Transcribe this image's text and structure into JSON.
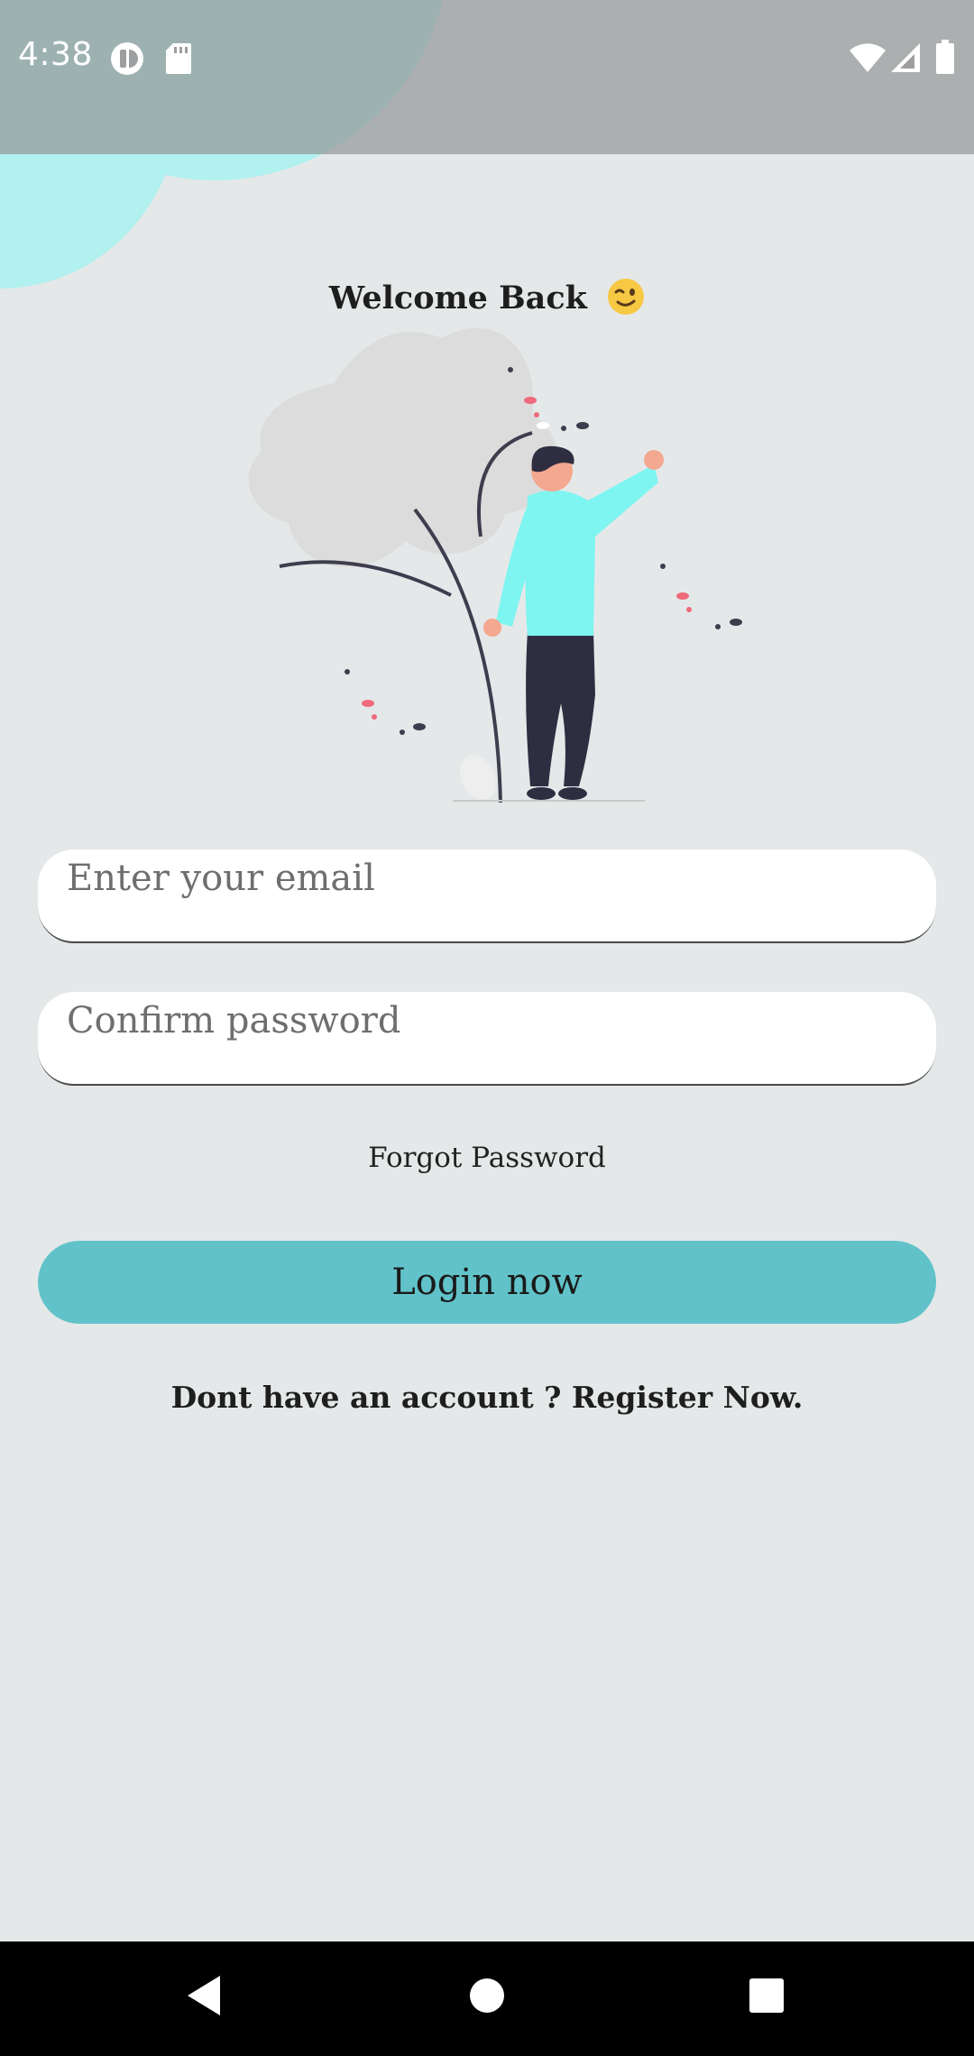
{
  "status_bar": {
    "time": "4:38",
    "left_icons": [
      "app-notification-icon",
      "sd-card-icon"
    ],
    "right_icons": [
      "wifi-icon",
      "signal-icon",
      "battery-icon"
    ]
  },
  "login": {
    "title": "Welcome Back",
    "title_emoji": "winking-face-icon",
    "email_placeholder": "Enter your email",
    "email_value": "",
    "password_placeholder": "Confirm password",
    "password_value": "",
    "forgot_label": "Forgot Password",
    "login_label": "Login now",
    "register_label": "Dont have an account ? Register Now."
  },
  "navigation": {
    "buttons": [
      "back-icon",
      "home-icon",
      "recents-icon"
    ]
  },
  "colors": {
    "background": "#e5e8e9",
    "accent": "#61c3c9",
    "decor_circle": "#b1f1ef",
    "person_shirt": "#7ef5f1",
    "nav_bar": "#000000"
  }
}
